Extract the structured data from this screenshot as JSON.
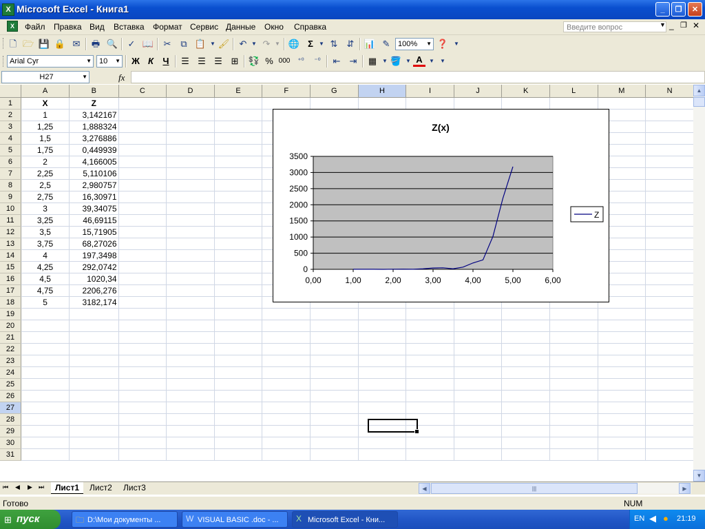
{
  "window": {
    "title": "Microsoft Excel - Книга1",
    "app_icon": "excel-icon"
  },
  "menu": {
    "items": [
      "Файл",
      "Правка",
      "Вид",
      "Вставка",
      "Формат",
      "Сервис",
      "Данные",
      "Окно",
      "Справка"
    ],
    "ask_placeholder": "Введите вопрос"
  },
  "toolbar": {
    "zoom": "100%",
    "font": "Arial Cyr",
    "size": "10",
    "bold": "Ж",
    "italic": "К",
    "underline": "Ч",
    "percent": "%",
    "thousands": "000",
    "sum": "Σ"
  },
  "formula_bar": {
    "name_box": "H27",
    "fx": "fx",
    "content": ""
  },
  "sheet": {
    "columns": [
      "A",
      "B",
      "C",
      "D",
      "E",
      "F",
      "G",
      "H",
      "I",
      "J",
      "K",
      "L",
      "M",
      "N"
    ],
    "selected_column": "H",
    "selected_row": 27,
    "header": [
      "X",
      "Z"
    ],
    "rows": [
      [
        "1",
        "3,142167"
      ],
      [
        "1,25",
        "1,888324"
      ],
      [
        "1,5",
        "3,276886"
      ],
      [
        "1,75",
        "0,449939"
      ],
      [
        "2",
        "4,166005"
      ],
      [
        "2,25",
        "5,110106"
      ],
      [
        "2,5",
        "2,980757"
      ],
      [
        "2,75",
        "16,30971"
      ],
      [
        "3",
        "39,34075"
      ],
      [
        "3,25",
        "46,69115"
      ],
      [
        "3,5",
        "15,71905"
      ],
      [
        "3,75",
        "68,27026"
      ],
      [
        "4",
        "197,3498"
      ],
      [
        "4,25",
        "292,0742"
      ],
      [
        "4,5",
        "1020,34"
      ],
      [
        "4,75",
        "2206,276"
      ],
      [
        "5",
        "3182,174"
      ]
    ],
    "tabs": [
      "Лист1",
      "Лист2",
      "Лист3"
    ],
    "active_tab": "Лист1"
  },
  "chart_data": {
    "type": "line",
    "title": "Z(x)",
    "x": [
      1,
      1.25,
      1.5,
      1.75,
      2,
      2.25,
      2.5,
      2.75,
      3,
      3.25,
      3.5,
      3.75,
      4,
      4.25,
      4.5,
      4.75,
      5
    ],
    "series": [
      {
        "name": "Z",
        "values": [
          3.142167,
          1.888324,
          3.276886,
          0.449939,
          4.166005,
          5.110106,
          2.980757,
          16.30971,
          39.34075,
          46.69115,
          15.71905,
          68.27026,
          197.3498,
          292.0742,
          1020.34,
          2206.276,
          3182.174
        ]
      }
    ],
    "xlim": [
      0,
      6
    ],
    "ylim": [
      0,
      3500
    ],
    "x_ticks": [
      "0,00",
      "1,00",
      "2,00",
      "3,00",
      "4,00",
      "5,00",
      "6,00"
    ],
    "y_ticks": [
      "0",
      "500",
      "1000",
      "1500",
      "2000",
      "2500",
      "3000",
      "3500"
    ],
    "grid": true,
    "legend": "right",
    "plot_bg": "#c0c0c0",
    "line_color": "#000080"
  },
  "status": {
    "left": "Готово",
    "right": "NUM"
  },
  "taskbar": {
    "start": "пуск",
    "tasks": [
      "D:\\Мои документы ...",
      "VISUAL BASIC .doc - ...",
      "Microsoft Excel - Кни..."
    ],
    "lang": "EN",
    "clock": "21:19"
  }
}
